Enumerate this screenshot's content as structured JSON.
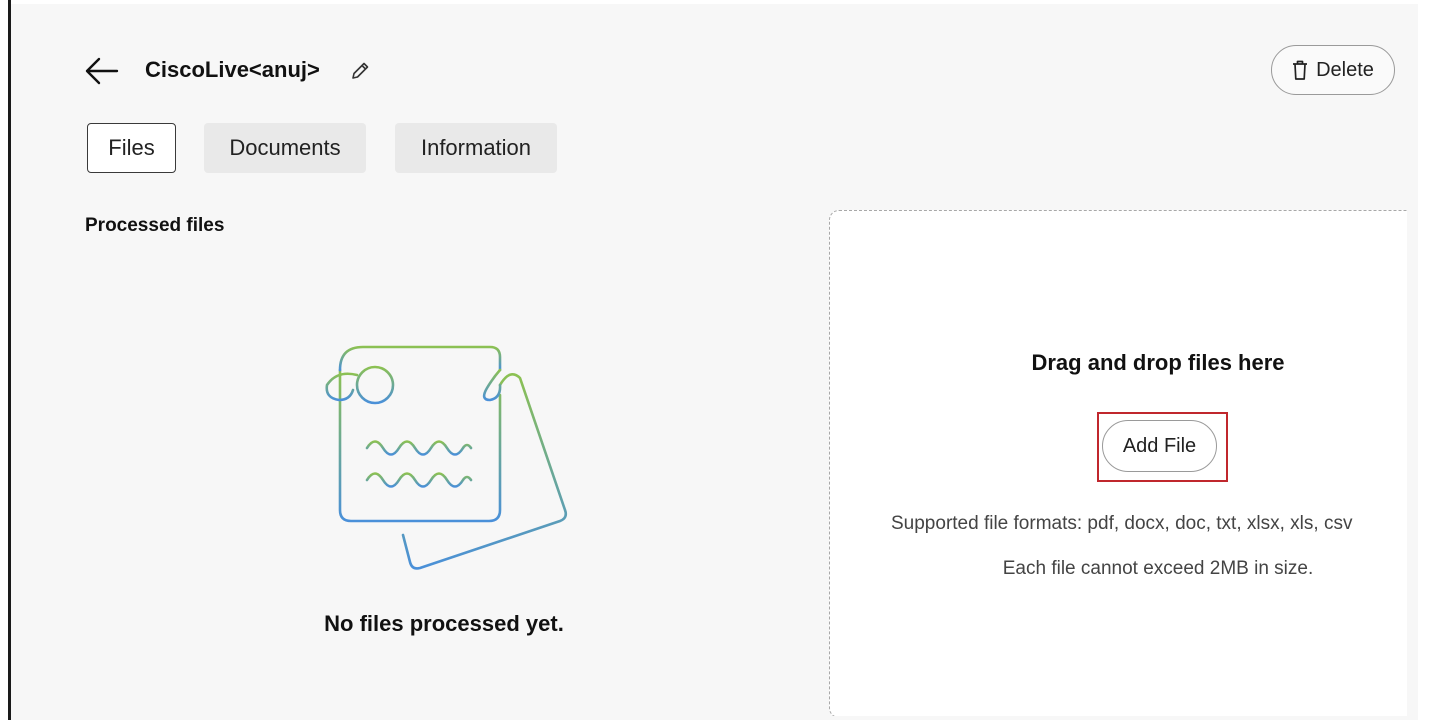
{
  "header": {
    "title": "CiscoLive<anuj>",
    "back_icon": "arrow-left-icon",
    "edit_icon": "pencil-icon",
    "delete_label": "Delete",
    "delete_icon": "trash-icon"
  },
  "tabs": [
    {
      "label": "Files",
      "active": true
    },
    {
      "label": "Documents",
      "active": false
    },
    {
      "label": "Information",
      "active": false
    }
  ],
  "processed": {
    "section_title": "Processed files",
    "empty_message": "No files processed yet.",
    "illustration": "empty-notes-illustration"
  },
  "dropzone": {
    "title": "Drag and drop files here",
    "add_label": "Add File",
    "formats_text": "Supported file formats: pdf, docx, doc, txt, xlsx, xls, csv",
    "size_text": "Each file cannot exceed 2MB in size."
  },
  "colors": {
    "highlight": "#c0272d",
    "illustration_top": "#8cc152",
    "illustration_bottom": "#4a90d9"
  }
}
